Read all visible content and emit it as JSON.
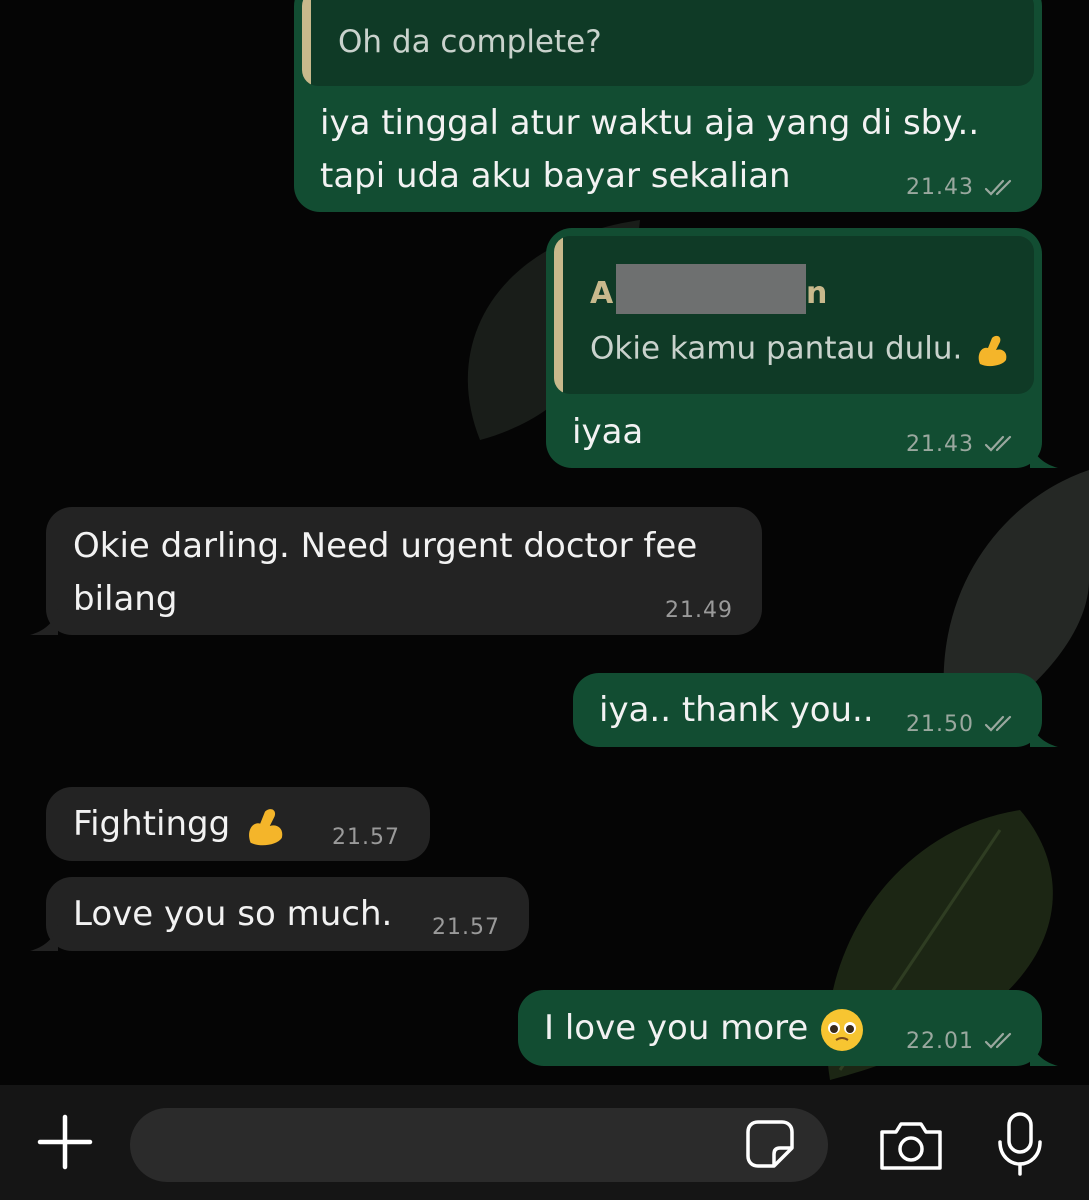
{
  "messages": [
    {
      "quote_text": "Oh da complete?",
      "line1": "iya tinggal atur waktu aja yang di sby..",
      "line2": "tapi uda aku bayar sekalian",
      "time": "21.43"
    },
    {
      "quote_author_start": "A",
      "quote_author_end": "n",
      "quote_text": "Okie kamu pantau dulu.",
      "text": "iyaa",
      "time": "21.43"
    },
    {
      "line1": "Okie darling. Need urgent doctor fee",
      "line2": "bilang",
      "time": "21.49"
    },
    {
      "text": "iya.. thank you..",
      "time": "21.50"
    },
    {
      "text": "Fightingg",
      "time": "21.57"
    },
    {
      "text": "Love you so much.",
      "time": "21.57"
    },
    {
      "text": "I love you more",
      "time": "22.01"
    }
  ],
  "icons": {
    "add": "plus-icon",
    "sticker": "sticker-icon",
    "camera": "camera-icon",
    "mic": "microphone-icon",
    "read": "double-check-icon",
    "flex": "flexed-biceps-emoji",
    "pleading": "pleading-face-emoji"
  },
  "colors": {
    "outgoing_bubble": "#124d32",
    "incoming_bubble": "#232323",
    "quote_bar": "#c8b98c",
    "background": "#050505"
  }
}
